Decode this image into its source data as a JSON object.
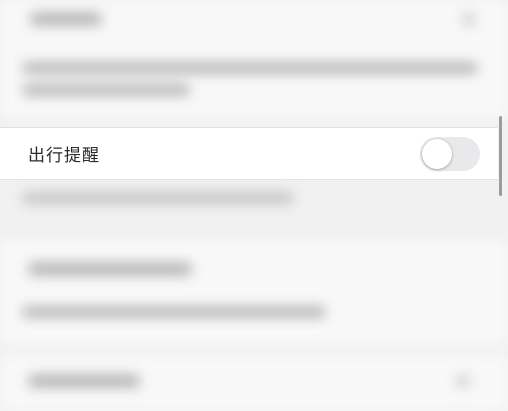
{
  "settings": {
    "travel_reminder": {
      "label": "出行提醒",
      "enabled": false
    }
  },
  "colors": {
    "toggle_off_track": "#e9e9eb",
    "row_background": "#ffffff",
    "screen_background": "#f1f1f2"
  }
}
